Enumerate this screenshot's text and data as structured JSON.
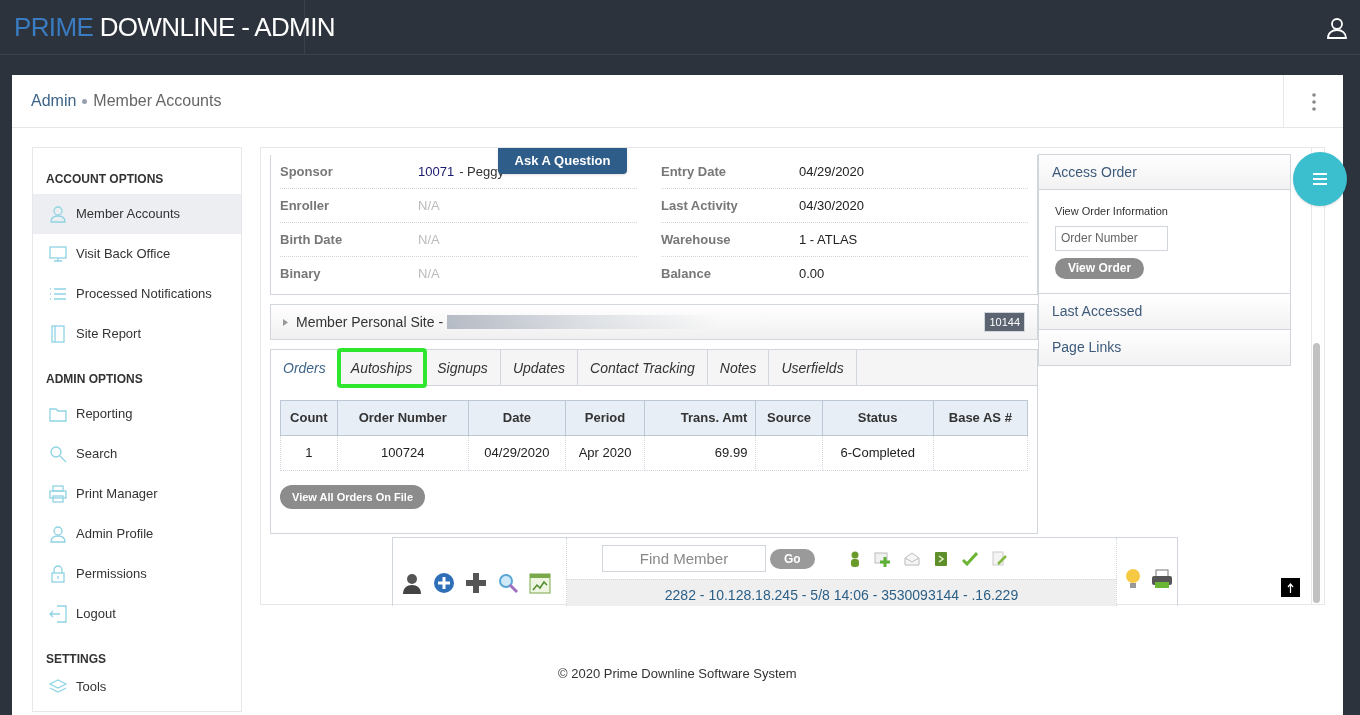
{
  "header": {
    "brand_prefix": "PRIME",
    "brand_rest": "DOWNLINE - ADMIN"
  },
  "breadcrumb": [
    {
      "label": "Admin",
      "kind": "link"
    },
    {
      "label": "Member Accounts",
      "kind": "current"
    }
  ],
  "sidebar": [
    {
      "title": "ACCOUNT OPTIONS",
      "items": [
        {
          "label": "Member Accounts",
          "selected": true
        },
        {
          "label": "Visit Back Office",
          "selected": false
        },
        {
          "label": "Processed Notifications",
          "selected": false
        },
        {
          "label": "Site Report",
          "selected": false
        }
      ]
    },
    {
      "title": "ADMIN OPTIONS",
      "items": [
        {
          "label": "Reporting",
          "selected": false
        },
        {
          "label": "Search",
          "selected": false
        },
        {
          "label": "Print Manager",
          "selected": false
        },
        {
          "label": "Admin Profile",
          "selected": false
        },
        {
          "label": "Permissions",
          "selected": false
        },
        {
          "label": "Logout",
          "selected": false
        }
      ]
    },
    {
      "title": "SETTINGS",
      "items": [
        {
          "label": "Tools",
          "selected": false
        }
      ]
    }
  ],
  "ask_button": "Ask A Question",
  "member_info": {
    "left": [
      {
        "label": "Sponsor",
        "kind": "link",
        "value": "10071",
        "extra": "- Peggy"
      },
      {
        "label": "Enroller",
        "kind": "muted",
        "value": "N/A"
      },
      {
        "label": "Birth Date",
        "kind": "muted",
        "value": "N/A"
      },
      {
        "label": "Binary",
        "kind": "muted",
        "value": "N/A"
      }
    ],
    "right": [
      {
        "label": "Entry Date",
        "kind": "plain",
        "value": "04/29/2020"
      },
      {
        "label": "Last Activity",
        "kind": "plain",
        "value": "04/30/2020"
      },
      {
        "label": "Warehouse",
        "kind": "plain",
        "value": "1 - ATLAS"
      },
      {
        "label": "Balance",
        "kind": "plain",
        "value": "0.00"
      }
    ]
  },
  "personal_site": {
    "label": "Member Personal Site -",
    "expanded": false,
    "badge": "10144"
  },
  "tabs": [
    {
      "label": "Orders",
      "selected": true,
      "highlighted": false
    },
    {
      "label": "Autoships",
      "selected": false,
      "highlighted": true
    },
    {
      "label": "Signups",
      "selected": false,
      "highlighted": false
    },
    {
      "label": "Updates",
      "selected": false,
      "highlighted": false
    },
    {
      "label": "Contact Tracking",
      "selected": false,
      "highlighted": false
    },
    {
      "label": "Notes",
      "selected": false,
      "highlighted": false
    },
    {
      "label": "Userfields",
      "selected": false,
      "highlighted": false
    }
  ],
  "orders_table": {
    "columns": [
      "Count",
      "Order Number",
      "Date",
      "Period",
      "Trans. Amt",
      "Source",
      "Status",
      "Base AS #"
    ],
    "rows": [
      [
        "1",
        "100724",
        "04/29/2020",
        "Apr 2020",
        "69.99",
        "",
        "6-Completed",
        ""
      ]
    ]
  },
  "view_all_button": "View All Orders On File",
  "toolbar": {
    "find_member": {
      "placeholder": "Find Member"
    },
    "go_button": "Go",
    "status": "2282 - 10.128.18.245 - 5/8 14:06 - 3530093144 - .16.229"
  },
  "right_panel": [
    {
      "title": "Access Order",
      "expanded": true,
      "caption": "View Order Information",
      "field": {
        "placeholder": "Order Number"
      },
      "button": "View Order"
    },
    {
      "title": "Last Accessed",
      "expanded": false
    },
    {
      "title": "Page Links",
      "expanded": false
    }
  ],
  "footer": "© 2020 Prime Downline Software System"
}
